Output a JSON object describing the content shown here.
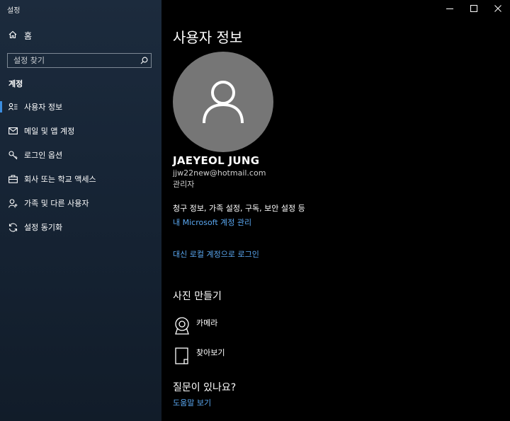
{
  "window": {
    "app_title": "설정",
    "controls": [
      "minimize-icon",
      "maximize-icon",
      "close-icon"
    ]
  },
  "sidebar": {
    "home_label": "홈",
    "search_placeholder": "설정 찾기",
    "section_label": "계정",
    "items": [
      {
        "label": "사용자 정보",
        "icon": "user-info-icon",
        "active": true
      },
      {
        "label": "메일 및 앱 계정",
        "icon": "mail-icon",
        "active": false
      },
      {
        "label": "로그인 옵션",
        "icon": "key-icon",
        "active": false
      },
      {
        "label": "회사 또는 학교 액세스",
        "icon": "briefcase-icon",
        "active": false
      },
      {
        "label": "가족 및 다른 사용자",
        "icon": "person-add-icon",
        "active": false
      },
      {
        "label": "설정 동기화",
        "icon": "sync-icon",
        "active": false
      }
    ]
  },
  "main": {
    "title": "사용자 정보",
    "user": {
      "name": "JAEYEOL JUNG",
      "email": "jjw22new@hotmail.com",
      "role": "관리자"
    },
    "billing_text": "청구 정보, 가족 설정, 구독, 보안 설정 등",
    "manage_link": "내 Microsoft 계정 관리",
    "local_signin_link": "대신 로컬 계정으로 로그인",
    "photo_section": {
      "title": "사진 만들기",
      "options": [
        {
          "label": "카메라",
          "icon": "camera-icon"
        },
        {
          "label": "찾아보기",
          "icon": "browse-icon"
        }
      ]
    },
    "question_section": {
      "title": "질문이 있나요?",
      "help_link": "도움말 보기"
    }
  },
  "colors": {
    "accent": "#3c8ee0",
    "link": "#5aa7f0",
    "sidebar_bg": "#172536",
    "main_bg": "#000000",
    "avatar_bg": "#767676"
  }
}
